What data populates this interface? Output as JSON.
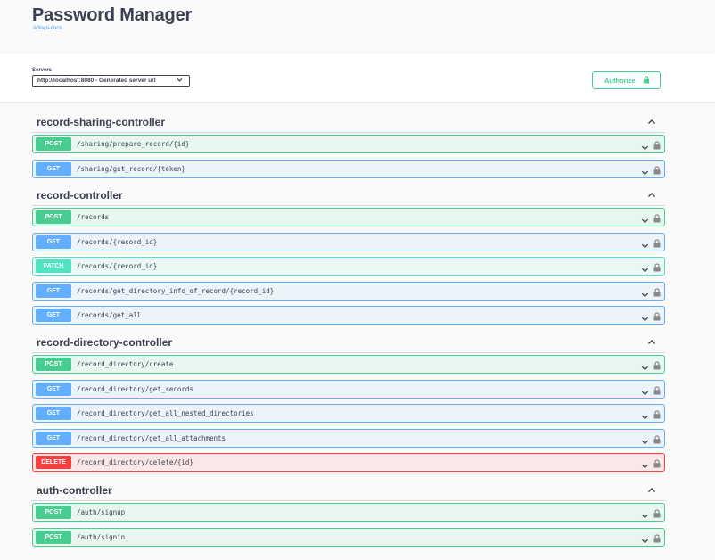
{
  "header": {
    "title": "Password Manager",
    "spec_link": "/v3/api-docs"
  },
  "servers": {
    "label": "Servers",
    "selected": "http://localhost:8080 - Generated server url"
  },
  "authorize": {
    "label": "Authorize"
  },
  "colors": {
    "post": "#49cc90",
    "get": "#61affe",
    "patch": "#50e3c2",
    "delete": "#f93e3e"
  },
  "tags": [
    {
      "name": "record-sharing-controller",
      "operations": [
        {
          "method": "POST",
          "path": "/sharing/prepare_record/{id}"
        },
        {
          "method": "GET",
          "path": "/sharing/get_record/{token}"
        }
      ]
    },
    {
      "name": "record-controller",
      "operations": [
        {
          "method": "POST",
          "path": "/records"
        },
        {
          "method": "GET",
          "path": "/records/{record_id}"
        },
        {
          "method": "PATCH",
          "path": "/records/{record_id}"
        },
        {
          "method": "GET",
          "path": "/records/get_directory_info_of_record/{record_id}"
        },
        {
          "method": "GET",
          "path": "/records/get_all"
        }
      ]
    },
    {
      "name": "record-directory-controller",
      "operations": [
        {
          "method": "POST",
          "path": "/record_directory/create"
        },
        {
          "method": "GET",
          "path": "/record_directory/get_records"
        },
        {
          "method": "GET",
          "path": "/record_directory/get_all_nested_directories"
        },
        {
          "method": "GET",
          "path": "/record_directory/get_all_attachments"
        },
        {
          "method": "DELETE",
          "path": "/record_directory/delete/{id}"
        }
      ]
    },
    {
      "name": "auth-controller",
      "operations": [
        {
          "method": "POST",
          "path": "/auth/signup"
        },
        {
          "method": "POST",
          "path": "/auth/signin"
        }
      ]
    }
  ]
}
